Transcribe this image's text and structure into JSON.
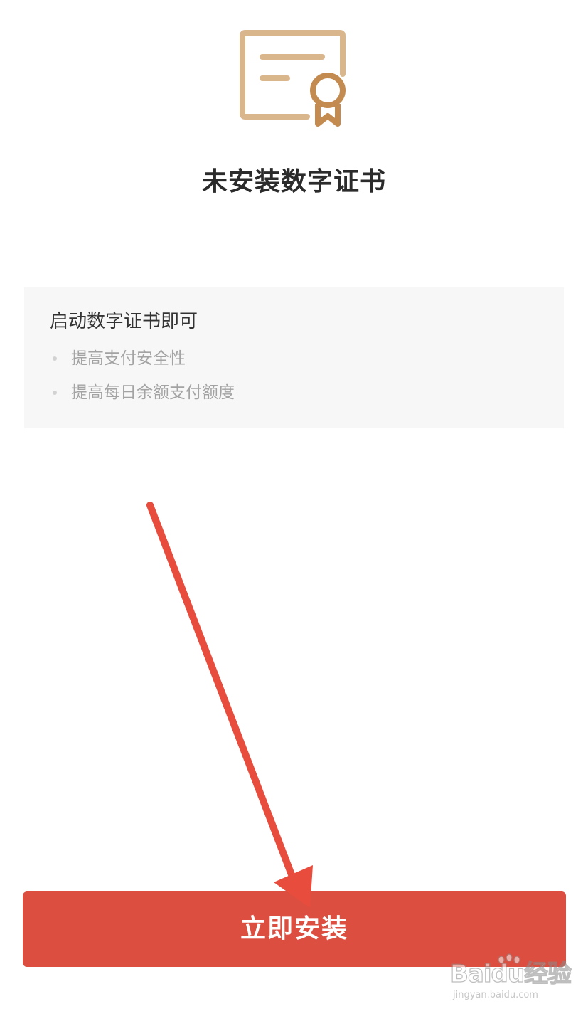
{
  "header": {
    "title": "未安装数字证书",
    "icon": "certificate-icon"
  },
  "info_card": {
    "heading": "启动数字证书即可",
    "benefits": [
      "提高支付安全性",
      "提高每日余额支付额度"
    ]
  },
  "actions": {
    "install_label": "立即安装"
  },
  "watermark": {
    "brand": "Baidu经验",
    "url": "jingyan.baidu.com"
  },
  "colors": {
    "icon_light": "#d9b68c",
    "icon_dark": "#c48b50",
    "button": "#dc4f40",
    "arrow": "#e84c3d"
  }
}
